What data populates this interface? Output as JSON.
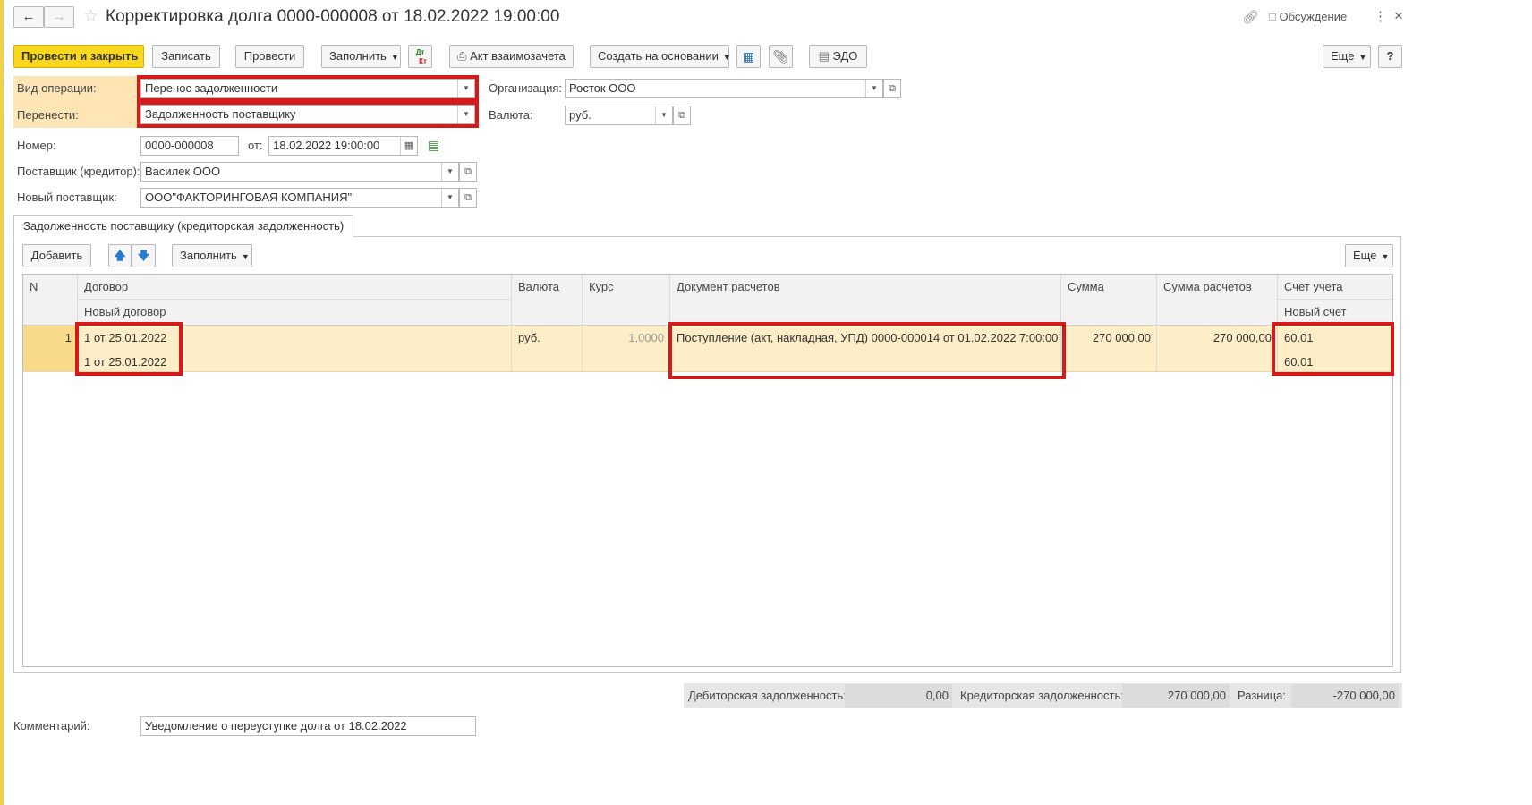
{
  "window": {
    "title": "Корректировка долга 0000-000008 от 18.02.2022 19:00:00",
    "discussion_label": "Обсуждение",
    "back_icon": "arrow-left-icon",
    "forward_icon": "arrow-right-icon",
    "favorite_icon": "star-icon"
  },
  "toolbar": {
    "post_close": "Провести и закрыть",
    "save": "Записать",
    "post": "Провести",
    "fill": "Заполнить",
    "dt_kt_top": "Дт",
    "dt_kt_bottom": "Кт",
    "act": "Акт взаимозачета",
    "create_based": "Создать на основании",
    "edo": "ЭДО",
    "more": "Еще",
    "help": "?"
  },
  "form": {
    "operation_label": "Вид операции:",
    "operation_value": "Перенос задолженности",
    "transfer_label": "Перенести:",
    "transfer_value": "Задолженность поставщику",
    "org_label": "Организация:",
    "org_value": "Росток ООО",
    "currency_label": "Валюта:",
    "currency_value": "руб.",
    "number_label": "Номер:",
    "number_value": "0000-000008",
    "date_label": "от:",
    "date_value": "18.02.2022 19:00:00",
    "supplier_label": "Поставщик (кредитор):",
    "supplier_value": "Василек ООО",
    "new_supplier_label": "Новый поставщик:",
    "new_supplier_value": "ООО\"ФАКТОРИНГОВАЯ КОМПАНИЯ\""
  },
  "tab": {
    "label": "Задолженность поставщику (кредиторская задолженность)"
  },
  "table_toolbar": {
    "add": "Добавить",
    "fill": "Заполнить",
    "more": "Еще"
  },
  "table": {
    "headers": {
      "n": "N",
      "contract": "Договор",
      "new_contract": "Новый договор",
      "currency": "Валюта",
      "rate": "Курс",
      "settlement_doc": "Документ расчетов",
      "sum": "Сумма",
      "settlement_sum": "Сумма расчетов",
      "account": "Счет учета",
      "new_account": "Новый счет"
    },
    "rows": [
      {
        "n": "1",
        "contract": "1 от 25.01.2022",
        "new_contract": "1 от 25.01.2022",
        "currency": "руб.",
        "rate": "1,0000",
        "settlement_doc": "Поступление (акт, накладная, УПД) 0000-000014 от 01.02.2022 7:00:00",
        "sum": "270 000,00",
        "settlement_sum": "270 000,00",
        "account": "60.01",
        "new_account": "60.01"
      }
    ]
  },
  "totals": {
    "debit_label": "Дебиторская задолженность:",
    "debit_value": "0,00",
    "credit_label": "Кредиторская задолженность:",
    "credit_value": "270 000,00",
    "diff_label": "Разница:",
    "diff_value": "-270 000,00"
  },
  "comment": {
    "label": "Комментарий:",
    "value": "Уведомление о переуступке долга от 18.02.2022"
  },
  "colors": {
    "primary_button": "#f9d71c",
    "highlight_red": "#d51a1a",
    "selected_row": "#fdeec8",
    "label_area": "#fde5b6"
  }
}
